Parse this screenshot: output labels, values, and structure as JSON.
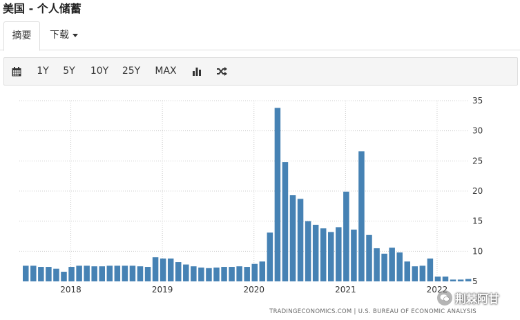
{
  "header": {
    "title": "美国 - 个人储蓄"
  },
  "tabs": [
    {
      "label": "摘要"
    },
    {
      "label": "下载"
    }
  ],
  "toolbar": {
    "ranges": [
      "1Y",
      "5Y",
      "10Y",
      "25Y",
      "MAX"
    ],
    "icons": [
      "calendar-icon",
      "bar-chart-icon",
      "shuffle-icon"
    ]
  },
  "source": "TRADINGECONOMICS.COM | U.S. BUREAU OF ECONOMIC ANALYSIS",
  "watermark": "荆棘阿甘",
  "colors": {
    "bar": "#4682b4",
    "grid": "#cccccc",
    "axis_text": "#333333"
  },
  "chart_data": {
    "type": "bar",
    "start_month": "2017-07",
    "values": [
      7.6,
      7.6,
      7.4,
      7.4,
      7.1,
      6.6,
      7.4,
      7.6,
      7.6,
      7.5,
      7.5,
      7.6,
      7.6,
      7.6,
      7.6,
      7.5,
      7.4,
      9.0,
      8.8,
      8.8,
      8.2,
      7.8,
      7.5,
      7.3,
      7.2,
      7.3,
      7.4,
      7.4,
      7.5,
      7.4,
      7.9,
      8.3,
      13.1,
      33.8,
      24.8,
      19.3,
      18.7,
      15.0,
      14.4,
      13.8,
      13.2,
      14.0,
      19.9,
      13.6,
      26.6,
      12.7,
      10.5,
      9.6,
      10.6,
      9.8,
      8.3,
      7.5,
      7.6,
      8.8,
      5.8,
      5.8,
      5.3,
      5.3,
      5.4
    ],
    "x_ticks": [
      "2018",
      "2019",
      "2020",
      "2021",
      "2022"
    ],
    "y_ticks": [
      5,
      10,
      15,
      20,
      25,
      30,
      35
    ],
    "ylim": [
      5,
      35
    ],
    "grid": true
  }
}
